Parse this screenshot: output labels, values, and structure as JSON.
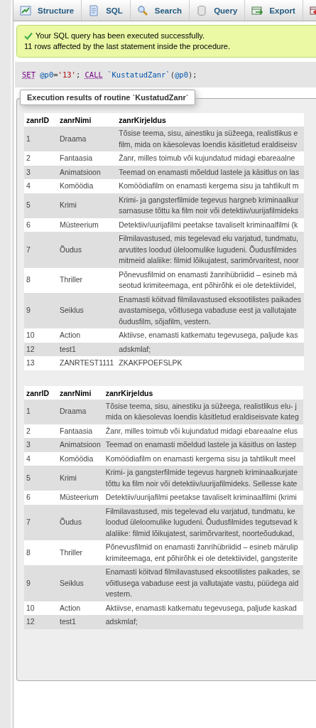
{
  "tabs": [
    {
      "label": "Structure",
      "selected": false
    },
    {
      "label": "SQL",
      "selected": false
    },
    {
      "label": "Search",
      "selected": false
    },
    {
      "label": "Query",
      "selected": false
    },
    {
      "label": "Export",
      "selected": false
    },
    {
      "selected": false
    }
  ],
  "message": {
    "kind": "success",
    "lines": [
      "Your SQL query has been executed successfully.",
      "11 rows affected by the last statement inside the procedure."
    ]
  },
  "sql": [
    {
      "kind": "keyword",
      "text": "SET"
    },
    {
      "kind": "variable",
      "text": " @p0"
    },
    {
      "kind": "punct",
      "text": "="
    },
    {
      "kind": "string",
      "text": "'13'"
    },
    {
      "kind": "punct",
      "text": "; "
    },
    {
      "kind": "keyword",
      "text": "CALL"
    },
    {
      "kind": "identifier",
      "text": " `KustatudZanr`"
    },
    {
      "kind": "punct",
      "text": "("
    },
    {
      "kind": "variable",
      "text": "@p0"
    },
    {
      "kind": "punct",
      "text": ");"
    }
  ],
  "results": {
    "legend": "Execution results of routine `KustatudZanr`",
    "tables": [
      {
        "columns": [
          "zanrID",
          "zanrNimi",
          "zanrKirjeldus"
        ],
        "rows": [
          [
            "1",
            "Draama",
            "Tõsise teema, sisu, ainestiku ja süžeega, realistlikus e\nfilm, mida on käesolevas loendis käsitletud eraldiseisv"
          ],
          [
            "2",
            "Fantaasia",
            "Žanr, milles toimub või kujundatud midagi ebareaalne"
          ],
          [
            "3",
            "Animatsioon",
            "Teemad on enamasti mõeldud lastele ja käsitlus on las"
          ],
          [
            "4",
            "Komöödia",
            "Komöödiafilm on enamasti kergema sisu ja tahtlikult m"
          ],
          [
            "5",
            "Krimi",
            "Krimi- ja gangsterfilmide tegevus hargneb kriminaalkur\nsarnasuse tõttu ka film noir või detektiiv/uurijafilmideks"
          ],
          [
            "6",
            "Müsteerium",
            "Detektiiv/uurijafilmi peetakse tavaliselt kriminaalfilmi (k"
          ],
          [
            "7",
            "Õudus",
            "Filmilavastused, mis tegelevad elu varjatud, tundmatu,\narvutites loodud üleloomulike lugudeni. Õudusfilmides\nmitmeid alaliike: filmid lõikujatest, sarimõrvaritest, noor"
          ],
          [
            "8",
            "Thriller",
            "Põnevusfilmid on enamasti žanrihübriidid – esineb mä\nseotud krimiteemaga, ent põhirõhk ei ole detektiividel,"
          ],
          [
            "9",
            "Seiklus",
            "Enamasti köitvad filmilavastused eksootilistes paikades\navastamisega, võitlusega vabaduse eest ja vallutajate\nõudusfilm, sõjafilm, vestern."
          ],
          [
            "10",
            "Action",
            "Aktiivse, enamasti katkematu tegevusega, paljude kas"
          ],
          [
            "12",
            "test1",
            "adskmlaf;"
          ],
          [
            "13",
            "ZANRTEST1111",
            "ZKAKFPOEFSLPK"
          ]
        ]
      },
      {
        "columns": [
          "zanrID",
          "zanrNimi",
          "zanrKirjeldus"
        ],
        "rows": [
          [
            "1",
            "Draama",
            "Tõsise teema, sisu, ainestiku ja süžeega, realistlikus elu- j\nmida on käesolevas loendis käsitletud eraldiseisvate kateg"
          ],
          [
            "2",
            "Fantaasia",
            "Žanr, milles toimub või kujundatud midagi ebareaalne elus"
          ],
          [
            "3",
            "Animatsioon",
            "Teemad on enamasti mõeldud lastele ja käsitlus on lastep"
          ],
          [
            "4",
            "Komöödia",
            "Komöödiafilm on enamasti kergema sisu ja tahtlikult meel"
          ],
          [
            "5",
            "Krimi",
            "Krimi- ja gangsterfilmide tegevus hargneb kriminaalkurjate\ntõttu ka film noir või detektiiv/uurijafilmideks. Sellesse kate"
          ],
          [
            "6",
            "Müsteerium",
            "Detektiiv/uurijafilmi peetakse tavaliselt kriminaalfilmi (krimi"
          ],
          [
            "7",
            "Õudus",
            "Filmilavastused, mis tegelevad elu varjatud, tundmatu, ke\nloodud üleloomulike lugudeni. Õudusfilmides tegutsevad k\nalaliike: filmid lõikujatest, sarimõrvaritest, noorteõudukad,"
          ],
          [
            "8",
            "Thriller",
            "Põnevusfilmid on enamasti žanrihübriidid – esineb märulip\nkrimiteemaga, ent põhirõhk ei ole detektiividel, gangsterite"
          ],
          [
            "9",
            "Seiklus",
            "Enamasti köitvad filmilavastused eksootilistes paikades, se\nvõitlusega vabaduse eest ja vallutajate vastu, püüdega aid\nvestern."
          ],
          [
            "10",
            "Action",
            "Aktiivse, enamasti katkematu tegevusega, paljude kaskad"
          ],
          [
            "12",
            "test1",
            "adskmlaf;"
          ]
        ]
      }
    ]
  }
}
